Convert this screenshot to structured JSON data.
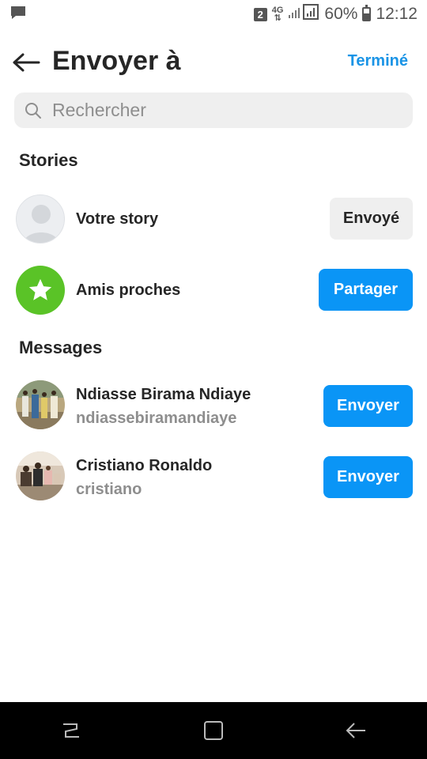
{
  "status_bar": {
    "sim": "2",
    "network": "4G",
    "battery": "60%",
    "battery_level": 0.6,
    "time": "12:12",
    "icons": [
      "message-icon",
      "sim-icon",
      "signal-icon",
      "battery-icon"
    ]
  },
  "header": {
    "title": "Envoyer à",
    "done_label": "Terminé"
  },
  "search": {
    "placeholder": "Rechercher"
  },
  "stories": {
    "section_title": "Stories",
    "items": [
      {
        "name": "Votre story",
        "button_label": "Envoyé",
        "button_style": "gray"
      },
      {
        "name": "Amis proches",
        "button_label": "Partager",
        "button_style": "blue"
      }
    ]
  },
  "messages": {
    "section_title": "Messages",
    "items": [
      {
        "name": "Ndiasse Birama Ndiaye",
        "username": "ndiassebiramandiaye",
        "button_label": "Envoyer"
      },
      {
        "name": "Cristiano Ronaldo",
        "username": "cristiano",
        "button_label": "Envoyer"
      }
    ]
  },
  "colors": {
    "accent": "#0a95f6",
    "link": "#1a94e6",
    "close_friends": "#5ac327",
    "secondary_text": "#8e8e8e"
  }
}
